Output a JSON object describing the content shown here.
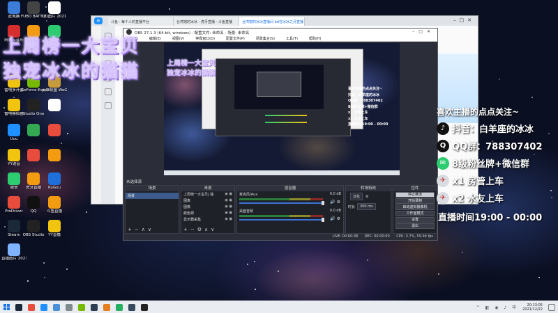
{
  "desktop": {
    "icons": [
      {
        "label": "此电脑",
        "icon": "computer-icon",
        "color": "#3b7dd8"
      },
      {
        "label": "FUBO BATTLEG...",
        "icon": "game-icon",
        "color": "#444444"
      },
      {
        "label": "QQ图片 20211213...",
        "icon": "image-icon",
        "color": "#ffffff"
      },
      {
        "label": "网易云音乐",
        "icon": "netease-music-icon",
        "color": "#d62d2d"
      },
      {
        "label": "",
        "icon": "app-icon",
        "color": "#f39c12"
      },
      {
        "label": "",
        "icon": "app-icon",
        "color": "#2ecc71"
      },
      {
        "label": "雷电多开器",
        "icon": "ldplayer-icon",
        "color": "#f1c40f"
      },
      {
        "label": "GeForce Experience",
        "icon": "nvidia-icon",
        "color": "#76b900"
      },
      {
        "label": "英雄联盟 WeGame版",
        "icon": "wegame-icon",
        "color": "#c59b3b"
      },
      {
        "label": "雷电模拟器",
        "icon": "ldplayer-icon",
        "color": "#f1c40f"
      },
      {
        "label": "Studio One",
        "icon": "studio-one-icon",
        "color": "#222222"
      },
      {
        "label": "",
        "icon": "app-icon",
        "color": "#ffffff"
      },
      {
        "label": "Uuu",
        "icon": "uu-icon",
        "color": "#1e90ff"
      },
      {
        "label": "",
        "icon": "chrome-icon",
        "color": "#34a853"
      },
      {
        "label": "",
        "icon": "app-icon",
        "color": "#e74c3c"
      },
      {
        "label": "YY语音",
        "icon": "yy-icon",
        "color": "#f1c40f"
      },
      {
        "label": "",
        "icon": "app-icon",
        "color": "#e74c3c"
      },
      {
        "label": "",
        "icon": "app-icon",
        "color": "#f39c12"
      },
      {
        "label": "微信",
        "icon": "wechat-icon",
        "color": "#2ecc71"
      },
      {
        "label": "虎牙直播",
        "icon": "huya-icon",
        "color": "#f39c12"
      },
      {
        "label": "KuGou",
        "icon": "kugou-icon",
        "color": "#1e6fd9"
      },
      {
        "label": "ProDriver",
        "icon": "prodriver-icon",
        "color": "#e74c3c"
      },
      {
        "label": "QQ",
        "icon": "qq-icon",
        "color": "#111111"
      },
      {
        "label": "斗鱼直播",
        "icon": "douyu-icon",
        "color": "#f39c12"
      },
      {
        "label": "Steam",
        "icon": "steam-icon",
        "color": "#1b2838"
      },
      {
        "label": "OBS Studio",
        "icon": "obs-icon",
        "color": "#222222"
      },
      {
        "label": "YY直播",
        "icon": "yy-live-icon",
        "color": "#f1c40f"
      },
      {
        "label": "直播图片 2021120...",
        "icon": "image-icon",
        "color": "#7fb3ff"
      }
    ]
  },
  "overlay": {
    "headline_1": "上周榜一大宝贝",
    "headline_2": "独宠冰冰的猫猫",
    "promo_heading": "喜欢主播的点点关注~",
    "promo_lines": [
      {
        "icon": "tiktok-icon",
        "text": "抖音：白羊座的冰冰",
        "color": "#111111"
      },
      {
        "icon": "qq-icon",
        "text": "QQ群：788307402",
        "color": "#111111"
      },
      {
        "icon": "wechat-icon",
        "text": "8级粉丝牌+微信群",
        "color": "#2ecc71"
      },
      {
        "icon": "plane-icon",
        "text": "x1 房管上车",
        "color": "#d9dde3"
      },
      {
        "icon": "plane-icon",
        "text": "x2 水友上车",
        "color": "#d9dde3"
      }
    ],
    "promo_time": "直播时间19:00 - 00:00"
  },
  "browser": {
    "tabs": [
      "斗鱼 - 每个人的直播平台",
      "台湾馆的冰冰 - 虎牙直播 - 斗鱼直播",
      "台湾馆的冰冰直播间 bd在冰冰之月直播"
    ]
  },
  "obs": {
    "title": "OBS 27.1.3 (64-bit, windows) - 配置文件: 未命名 - 场景: 未命名",
    "menu": [
      "文件(F)",
      "编辑(E)",
      "视图(V)",
      "停靠窗口(D)",
      "配置文件(P)",
      "场景集合(S)",
      "工具(T)",
      "帮助(H)"
    ],
    "scene_transition_label": "未选择源",
    "docks": {
      "scenes": {
        "title": "场景",
        "items": [
          "场景"
        ]
      },
      "sources": {
        "title": "来源",
        "items": [
          "上周榜一大宝贝| 独",
          "图像",
          "图像",
          "颜色源",
          "显示器采集"
        ]
      },
      "mixer": {
        "title": "混音器",
        "channels": [
          {
            "name": "麦克风/Aux",
            "value": "0.0 dB"
          },
          {
            "name": "桌面音频",
            "value": "0.0 dB"
          }
        ]
      },
      "transitions": {
        "title": "转场特效",
        "mode": "淡化",
        "duration_label": "时长",
        "duration": "300 ms"
      },
      "controls": {
        "title": "控件",
        "buttons": [
          "停止推流",
          "开始录制",
          "启动虚拟摄像机",
          "工作室模式",
          "设置",
          "退出"
        ]
      }
    },
    "status": {
      "live": "LIVE: 00:00:38",
      "rec": "REC: 00:00:00",
      "cpu": "CPU: 3.7%, 59.94 fps"
    }
  },
  "nested_preview": {
    "headline_1": "上周榜一大宝贝",
    "headline_2": "独宠冰冰的猫猫",
    "promo": [
      "喜欢主播的点点关注~",
      "抖音：白羊座的冰冰",
      "QQ群：788307402",
      "8级粉丝牌+微信群",
      "x1 房管上车",
      "x2 水友上车",
      "直播时间19:00 - 00:00"
    ]
  },
  "taskbar": {
    "pinned": [
      {
        "icon": "steam-icon",
        "color": "#1b2838"
      },
      {
        "icon": "app-icon",
        "color": "#e74c3c"
      },
      {
        "icon": "qq-icon",
        "color": "#1e90ff"
      },
      {
        "icon": "app-icon",
        "color": "#4a90d9"
      },
      {
        "icon": "app-icon",
        "color": "#7f8c8d"
      },
      {
        "icon": "nvidia-icon",
        "color": "#76b900"
      },
      {
        "icon": "app-icon",
        "color": "#2c3e50"
      },
      {
        "icon": "app-icon",
        "color": "#e67e22"
      },
      {
        "icon": "app-icon",
        "color": "#27ae60"
      },
      {
        "icon": "app-icon",
        "color": "#34495e"
      },
      {
        "icon": "obs-icon",
        "color": "#222222"
      }
    ],
    "clock_time": "20:13:05",
    "clock_date": "2021/12/22"
  }
}
